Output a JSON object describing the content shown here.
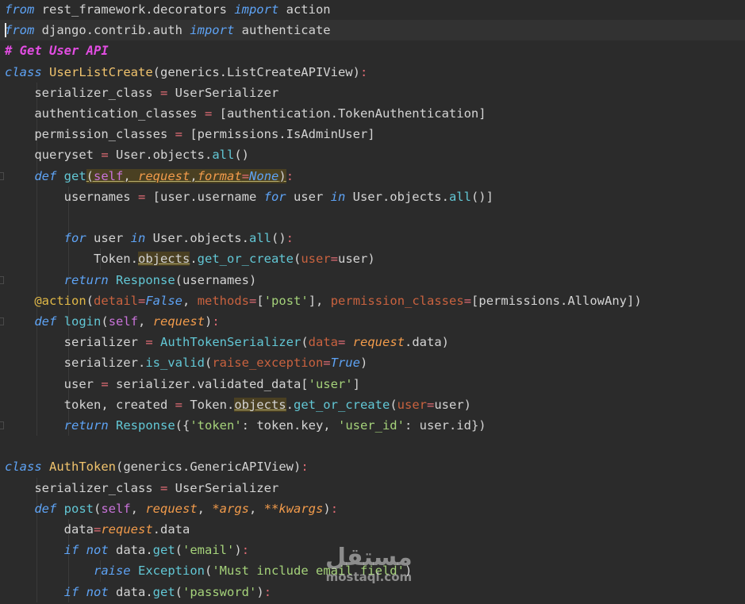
{
  "watermark": {
    "arabic": "مستقل",
    "latin": "mostaql.com"
  },
  "lines": [
    [
      [
        "from",
        "kw"
      ],
      [
        " rest_framework.decorators ",
        ""
      ],
      [
        "import",
        "kw"
      ],
      [
        " action",
        ""
      ]
    ],
    [
      [
        "from",
        "kw"
      ],
      [
        " django.contrib.auth ",
        ""
      ],
      [
        "import",
        "kw"
      ],
      [
        " authenticate",
        ""
      ]
    ],
    [
      [
        "# Get User API",
        "comment"
      ]
    ],
    [
      [
        "class",
        "kw"
      ],
      [
        " ",
        ""
      ],
      [
        "UserListCreate",
        "cls"
      ],
      [
        "(generics.ListCreateAPIView)",
        ""
      ],
      [
        ":",
        "op"
      ]
    ],
    [
      [
        "    serializer_class ",
        ""
      ],
      [
        "=",
        "op"
      ],
      [
        " UserSerializer",
        ""
      ]
    ],
    [
      [
        "    authentication_classes ",
        ""
      ],
      [
        "=",
        "op"
      ],
      [
        " [authentication.TokenAuthentication]",
        ""
      ]
    ],
    [
      [
        "    permission_classes ",
        ""
      ],
      [
        "=",
        "op"
      ],
      [
        " [permissions.IsAdminUser]",
        ""
      ]
    ],
    [
      [
        "    queryset ",
        ""
      ],
      [
        "=",
        "op"
      ],
      [
        " User.objects.",
        ""
      ],
      [
        "all",
        "builtin"
      ],
      [
        "()",
        ""
      ]
    ],
    [
      [
        "    ",
        ""
      ],
      [
        "def",
        "kw"
      ],
      [
        " ",
        ""
      ],
      [
        "get",
        "fn"
      ],
      [
        "(",
        "hl u"
      ],
      [
        "self",
        "self hl u"
      ],
      [
        ", ",
        "hl u"
      ],
      [
        "request",
        "param hl u"
      ],
      [
        ",",
        "hl u"
      ],
      [
        "format",
        "param hl u"
      ],
      [
        "=",
        "op hl u"
      ],
      [
        "None",
        "const hl u"
      ],
      [
        ")",
        "hl u"
      ],
      [
        ":",
        "op"
      ]
    ],
    [
      [
        "        usernames ",
        ""
      ],
      [
        "=",
        "op"
      ],
      [
        " [user.username ",
        ""
      ],
      [
        "for",
        "kw"
      ],
      [
        " user ",
        ""
      ],
      [
        "in",
        "kw"
      ],
      [
        " User.objects.",
        ""
      ],
      [
        "all",
        "builtin"
      ],
      [
        "()]",
        ""
      ]
    ],
    [],
    [
      [
        "        ",
        ""
      ],
      [
        "for",
        "kw"
      ],
      [
        " user ",
        ""
      ],
      [
        "in",
        "kw"
      ],
      [
        " User.objects.",
        ""
      ],
      [
        "all",
        "builtin"
      ],
      [
        "()",
        ""
      ],
      [
        ":",
        "op"
      ]
    ],
    [
      [
        "            Token.",
        ""
      ],
      [
        "objects",
        "hl u"
      ],
      [
        ".",
        ""
      ],
      [
        "get_or_create",
        "fn"
      ],
      [
        "(",
        ""
      ],
      [
        "user",
        "kwarg"
      ],
      [
        "=",
        "op"
      ],
      [
        "user)",
        ""
      ]
    ],
    [
      [
        "        ",
        ""
      ],
      [
        "return",
        "kw"
      ],
      [
        " ",
        ""
      ],
      [
        "Response",
        "fn"
      ],
      [
        "(usernames)",
        ""
      ]
    ],
    [
      [
        "    ",
        ""
      ],
      [
        "@action",
        "deco"
      ],
      [
        "(",
        ""
      ],
      [
        "detail",
        "kwarg"
      ],
      [
        "=",
        "op"
      ],
      [
        "False",
        "const"
      ],
      [
        ", ",
        ""
      ],
      [
        "methods",
        "kwarg"
      ],
      [
        "=",
        "op"
      ],
      [
        "[",
        ""
      ],
      [
        "'post'",
        "str"
      ],
      [
        "], ",
        ""
      ],
      [
        "permission_classes",
        "kwarg"
      ],
      [
        "=",
        "op"
      ],
      [
        "[permissions.AllowAny])",
        ""
      ]
    ],
    [
      [
        "    ",
        ""
      ],
      [
        "def",
        "kw"
      ],
      [
        " ",
        ""
      ],
      [
        "login",
        "fn"
      ],
      [
        "(",
        ""
      ],
      [
        "self",
        "self"
      ],
      [
        ", ",
        ""
      ],
      [
        "request",
        "param"
      ],
      [
        ")",
        ""
      ],
      [
        ":",
        "op"
      ]
    ],
    [
      [
        "        serializer ",
        ""
      ],
      [
        "=",
        "op"
      ],
      [
        " ",
        ""
      ],
      [
        "AuthTokenSerializer",
        "fn"
      ],
      [
        "(",
        ""
      ],
      [
        "data",
        "kwarg"
      ],
      [
        "=",
        "op"
      ],
      [
        " ",
        ""
      ],
      [
        "request",
        "param"
      ],
      [
        ".data)",
        ""
      ]
    ],
    [
      [
        "        serializer.",
        ""
      ],
      [
        "is_valid",
        "fn"
      ],
      [
        "(",
        ""
      ],
      [
        "raise_exception",
        "kwarg"
      ],
      [
        "=",
        "op"
      ],
      [
        "True",
        "const"
      ],
      [
        ")",
        ""
      ]
    ],
    [
      [
        "        user ",
        ""
      ],
      [
        "=",
        "op"
      ],
      [
        " serializer.validated_data[",
        ""
      ],
      [
        "'user'",
        "str"
      ],
      [
        "]",
        ""
      ]
    ],
    [
      [
        "        token, created ",
        ""
      ],
      [
        "=",
        "op"
      ],
      [
        " Token.",
        ""
      ],
      [
        "objects",
        "hl u"
      ],
      [
        ".",
        ""
      ],
      [
        "get_or_create",
        "fn"
      ],
      [
        "(",
        ""
      ],
      [
        "user",
        "kwarg"
      ],
      [
        "=",
        "op"
      ],
      [
        "user)",
        ""
      ]
    ],
    [
      [
        "        ",
        ""
      ],
      [
        "return",
        "kw"
      ],
      [
        " ",
        ""
      ],
      [
        "Response",
        "fn"
      ],
      [
        "({",
        ""
      ],
      [
        "'token'",
        "str"
      ],
      [
        ": token.key, ",
        ""
      ],
      [
        "'user_id'",
        "str"
      ],
      [
        ": user.id})",
        ""
      ]
    ],
    [],
    [
      [
        "class",
        "kw"
      ],
      [
        " ",
        ""
      ],
      [
        "AuthToken",
        "cls"
      ],
      [
        "(generics.GenericAPIView)",
        ""
      ],
      [
        ":",
        "op"
      ]
    ],
    [
      [
        "    serializer_class ",
        ""
      ],
      [
        "=",
        "op"
      ],
      [
        " UserSerializer",
        ""
      ]
    ],
    [
      [
        "    ",
        ""
      ],
      [
        "def",
        "kw"
      ],
      [
        " ",
        ""
      ],
      [
        "post",
        "fn"
      ],
      [
        "(",
        ""
      ],
      [
        "self",
        "self"
      ],
      [
        ", ",
        ""
      ],
      [
        "request",
        "param"
      ],
      [
        ", ",
        ""
      ],
      [
        "*args",
        "param"
      ],
      [
        ", ",
        ""
      ],
      [
        "**kwargs",
        "param"
      ],
      [
        ")",
        ""
      ],
      [
        ":",
        "op"
      ]
    ],
    [
      [
        "        data",
        ""
      ],
      [
        "=",
        "op"
      ],
      [
        "request",
        "param"
      ],
      [
        ".data",
        ""
      ]
    ],
    [
      [
        "        ",
        ""
      ],
      [
        "if",
        "kw"
      ],
      [
        " ",
        ""
      ],
      [
        "not",
        "kw"
      ],
      [
        " data.",
        ""
      ],
      [
        "get",
        "fn"
      ],
      [
        "(",
        ""
      ],
      [
        "'email'",
        "str"
      ],
      [
        ")",
        ""
      ],
      [
        ":",
        "op"
      ]
    ],
    [
      [
        "            ",
        ""
      ],
      [
        "raise",
        "kw"
      ],
      [
        " ",
        ""
      ],
      [
        "Exception",
        "fn"
      ],
      [
        "(",
        ""
      ],
      [
        "'Must include email field'",
        "str"
      ],
      [
        ")",
        ""
      ]
    ],
    [
      [
        "        ",
        ""
      ],
      [
        "if",
        "kw"
      ],
      [
        " ",
        ""
      ],
      [
        "not",
        "kw"
      ],
      [
        " data.",
        ""
      ],
      [
        "get",
        "fn"
      ],
      [
        "(",
        ""
      ],
      [
        "'password'",
        "str"
      ],
      [
        ")",
        ""
      ],
      [
        ":",
        "op"
      ]
    ]
  ]
}
